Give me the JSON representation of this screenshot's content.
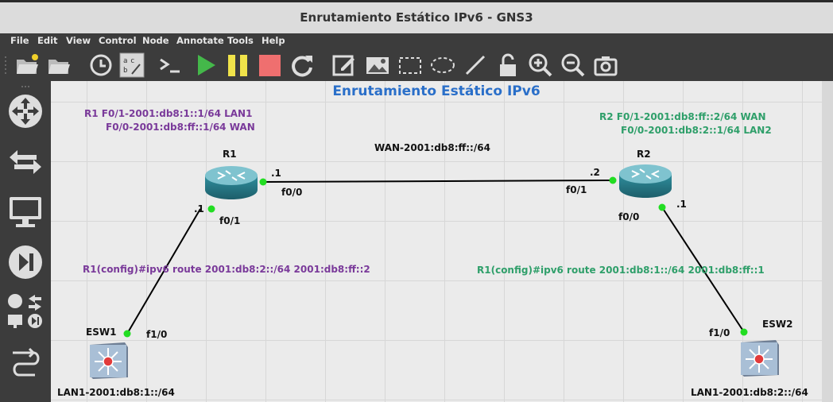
{
  "window": {
    "title": "Enrutamiento Estático IPv6 - GNS3"
  },
  "menu": [
    "File",
    "Edit",
    "View",
    "Control",
    "Node",
    "Annotate",
    "Tools",
    "Help"
  ],
  "toolbar_icons": [
    "open-project-icon",
    "open-folder-icon",
    "clock-icon",
    "snapshot-abc-icon",
    "console-icon",
    "start-icon",
    "pause-icon",
    "stop-icon",
    "reload-icon",
    "edit-note-icon",
    "insert-image-icon",
    "draw-rectangle-icon",
    "draw-ellipse-icon",
    "draw-line-icon",
    "lock-icon",
    "zoom-in-icon",
    "zoom-out-icon",
    "screenshot-icon"
  ],
  "sidebar_icons": [
    "routers-icon",
    "switches-icon",
    "end-devices-icon",
    "security-devices-icon",
    "all-devices-icon",
    "add-link-icon"
  ],
  "canvas": {
    "title": "Enrutamiento Estático IPv6",
    "r1_note_line1": "R1  F0/1-2001:db8:1::1/64 LAN1",
    "r1_note_line2": "F0/0-2001:db8:ff::1/64 WAN",
    "r2_note_line1": "R2  F0/1-2001:db8:ff::2/64 WAN",
    "r2_note_line2": "F0/0-2001:db8:2::1/64  LAN2",
    "wan_label": "WAN-2001:db8:ff::/64",
    "r1_cmd": "R1(config)#ipv6 route 2001:db8:2::/64  2001:db8:ff::2",
    "r2_cmd": "R1(config)#ipv6 route 2001:db8:1::/64  2001:db8:ff::1",
    "lan1_label": "LAN1-2001:db8:1::/64",
    "lan2_label": "LAN1-2001:db8:2::/64"
  },
  "nodes": {
    "r1": {
      "name": "R1"
    },
    "r2": {
      "name": "R2"
    },
    "esw1": {
      "name": "ESW1"
    },
    "esw2": {
      "name": "ESW2"
    }
  },
  "links": {
    "r1_f00": "f0/0",
    "r1_f00_addr": ".1",
    "r2_f01": "f0/1",
    "r2_f01_addr": ".2",
    "r1_f01": "f0/1",
    "r1_f01_addr": ".1",
    "r2_f00": "f0/0",
    "r2_f00_addr": ".1",
    "esw1_f10": "f1/0",
    "esw2_f10": "f1/0"
  },
  "colors": {
    "accent_title": "#2a6fc9",
    "r1_notes": "#7a3a9a",
    "r2_notes": "#2f9f6a",
    "link_up": "#22dd22"
  }
}
